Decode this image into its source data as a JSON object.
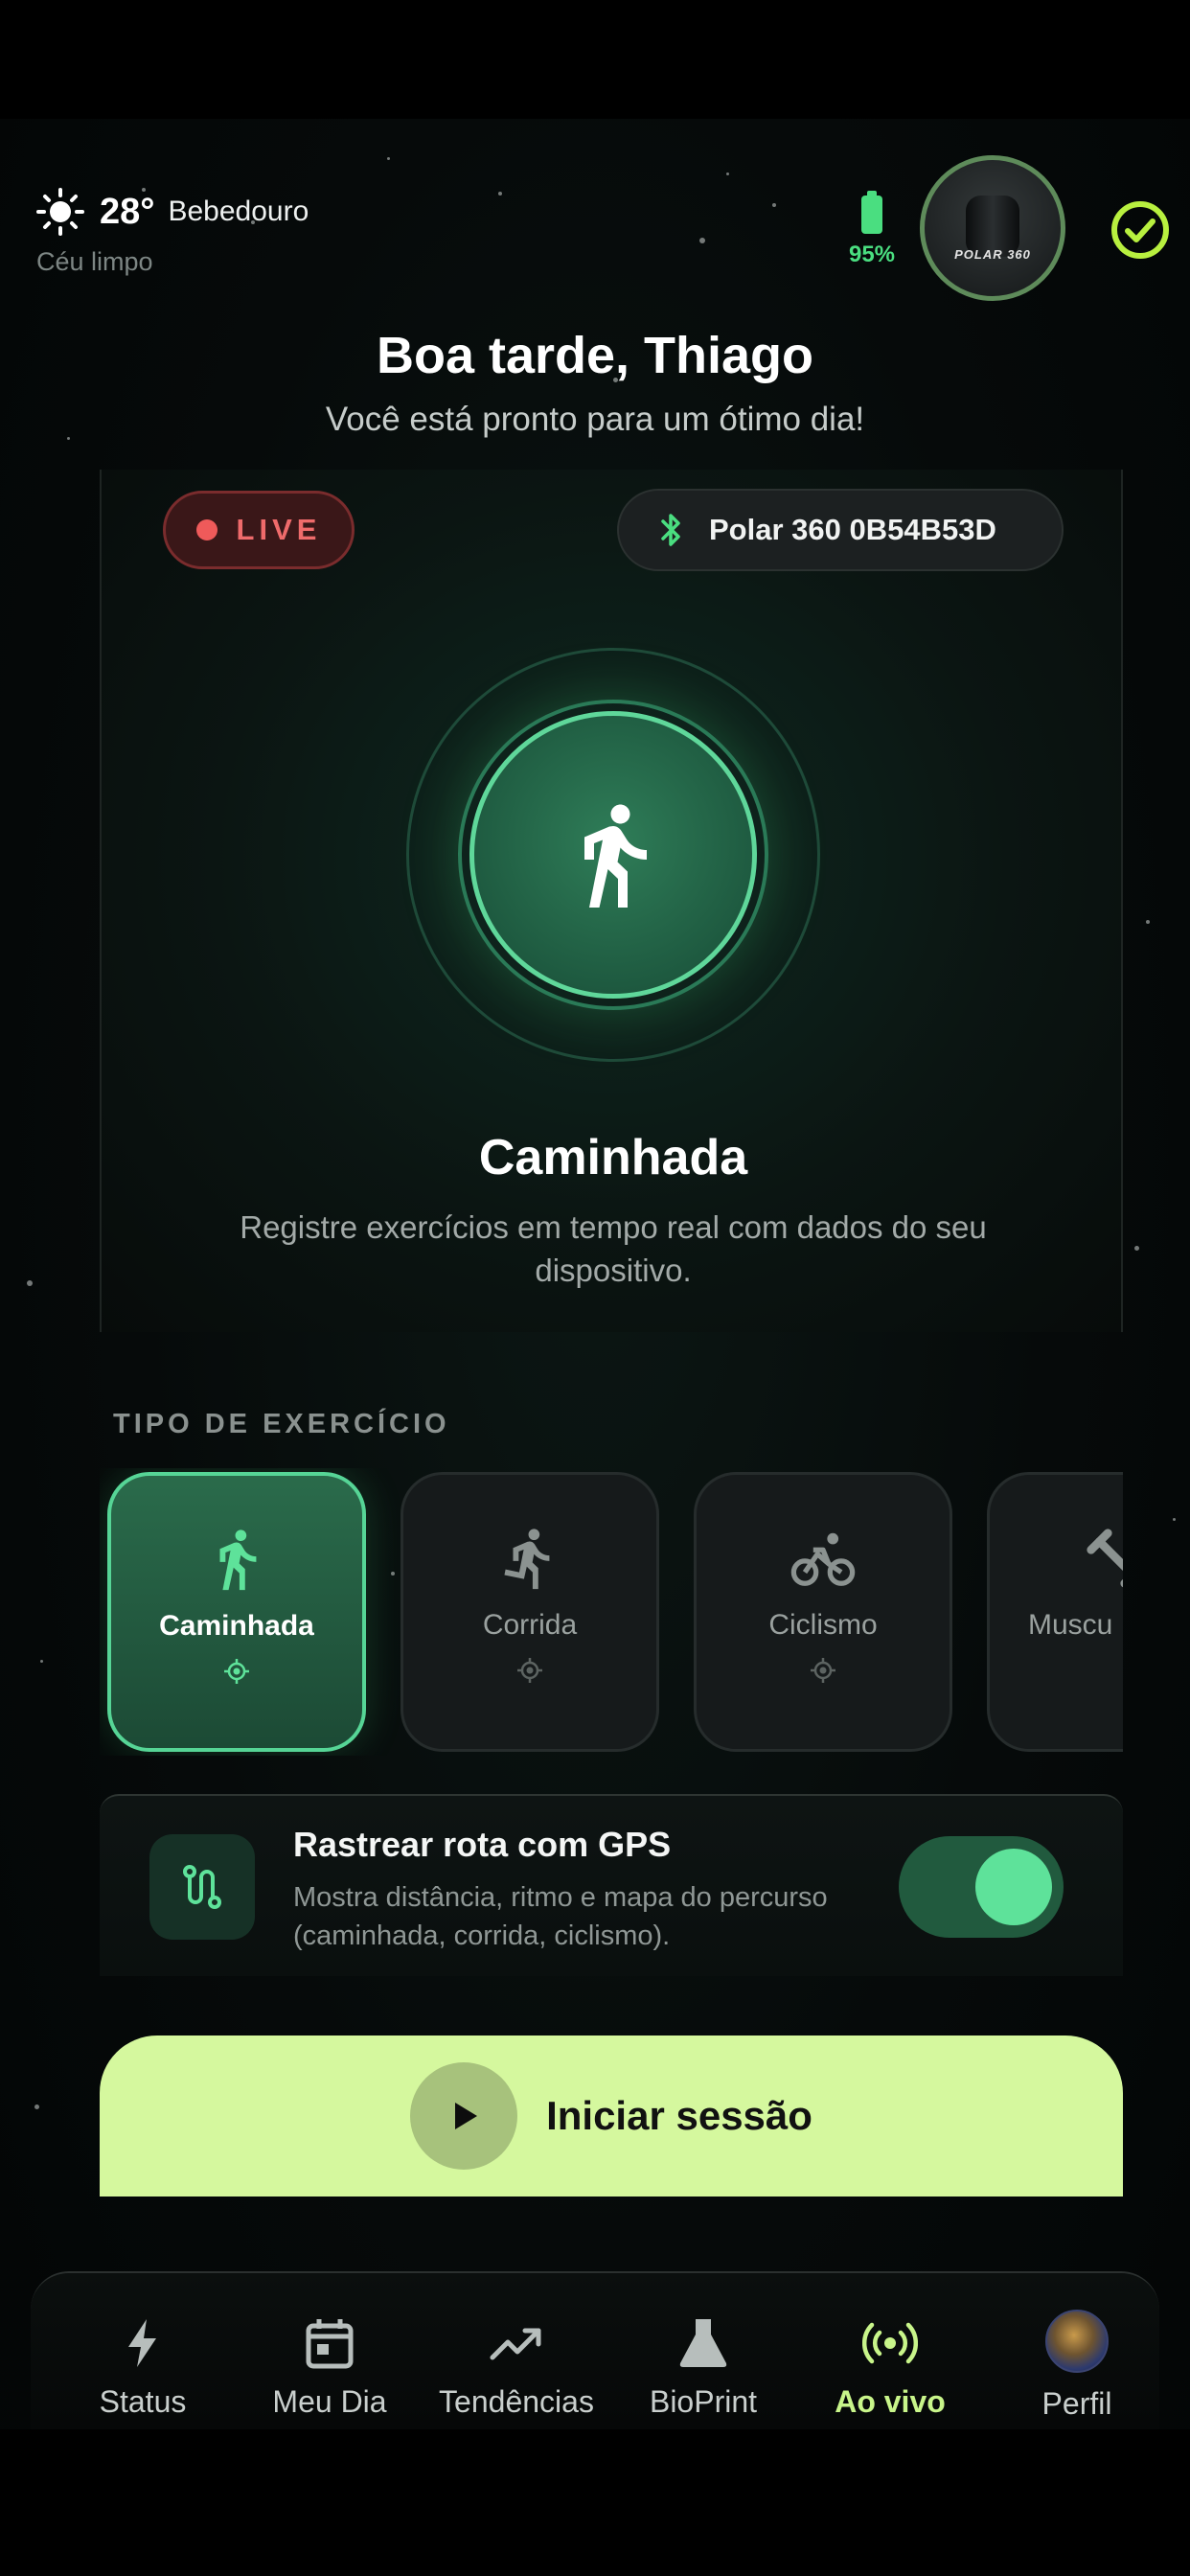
{
  "status": {
    "weather_temp": "28°",
    "weather_city": "Bebedouro",
    "weather_desc": "Céu limpo",
    "battery_level": "95%",
    "device_avatar_label": "POLAR 360"
  },
  "header": {
    "greeting": "Boa tarde, Thiago",
    "subtitle": "Você está pronto para um ótimo dia!"
  },
  "live_card": {
    "live_label": "LIVE",
    "device_name": "Polar 360 0B54B53D",
    "activity_title": "Caminhada",
    "activity_desc": "Registre exercícios em tempo real com dados do seu dispositivo."
  },
  "exercise_types": {
    "section_label": "TIPO DE EXERCÍCIO",
    "items": [
      {
        "label": "Caminhada",
        "icon": "walk-icon",
        "selected": true
      },
      {
        "label": "Corrida",
        "icon": "run-icon",
        "selected": false
      },
      {
        "label": "Ciclismo",
        "icon": "bike-icon",
        "selected": false
      },
      {
        "label": "Muscu",
        "icon": "dumbbell-icon",
        "selected": false
      }
    ]
  },
  "gps": {
    "title": "Rastrear rota com GPS",
    "description": "Mostra distância, ritmo e mapa do percurso (caminhada, corrida, ciclismo).",
    "enabled": true
  },
  "start": {
    "label": "Iniciar sessão"
  },
  "tabbar": {
    "items": [
      {
        "label": "Status",
        "icon": "bolt-icon"
      },
      {
        "label": "Meu Dia",
        "icon": "calendar-icon"
      },
      {
        "label": "Tendências",
        "icon": "trend-icon"
      },
      {
        "label": "BioPrint",
        "icon": "flask-icon"
      },
      {
        "label": "Ao vivo",
        "icon": "broadcast-icon",
        "active": true
      },
      {
        "label": "Perfil",
        "icon": "avatar"
      }
    ]
  },
  "colors": {
    "accent_green": "#4ade80",
    "lime": "#d5f89e",
    "live_red": "#ef5a5a",
    "active_tab": "#c8f58a"
  }
}
